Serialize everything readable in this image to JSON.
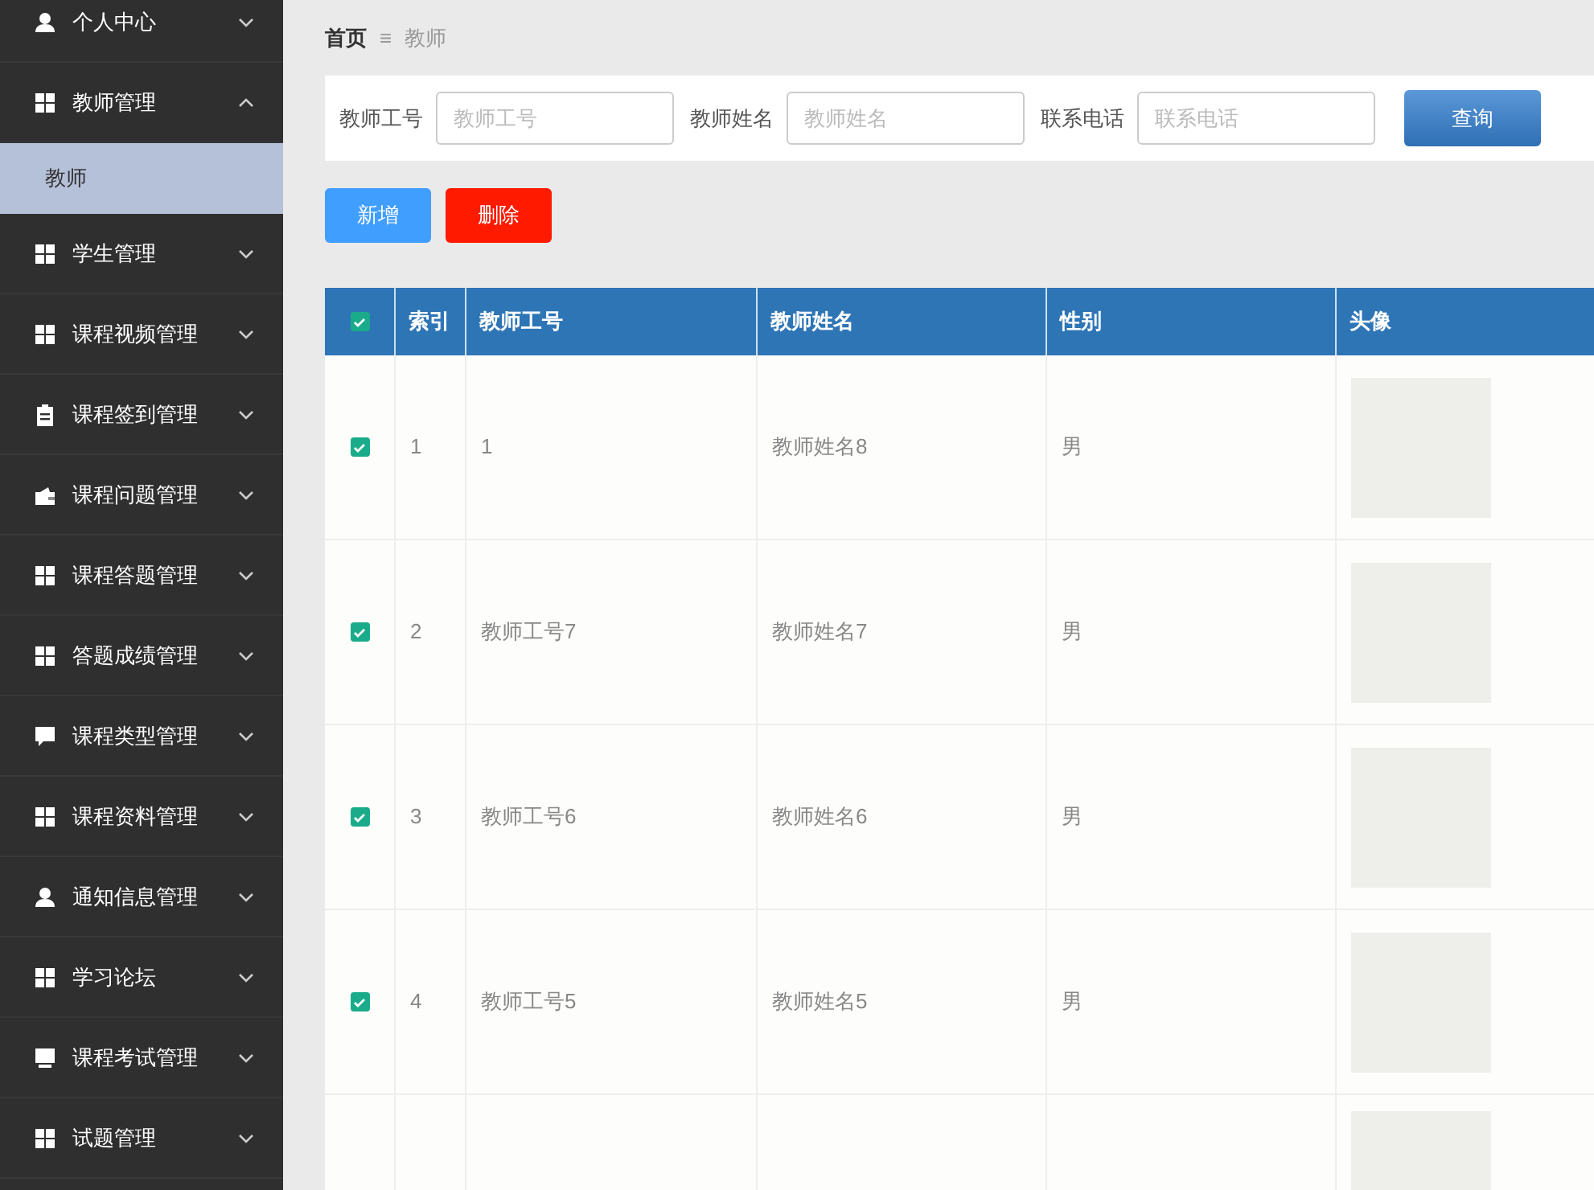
{
  "sidebar": {
    "items": [
      {
        "label": "个人中心",
        "expanded": false
      },
      {
        "label": "教师管理",
        "expanded": true,
        "children": [
          {
            "label": "教师",
            "selected": true
          }
        ]
      },
      {
        "label": "学生管理",
        "expanded": false
      },
      {
        "label": "课程视频管理",
        "expanded": false
      },
      {
        "label": "课程签到管理",
        "expanded": false
      },
      {
        "label": "课程问题管理",
        "expanded": false
      },
      {
        "label": "课程答题管理",
        "expanded": false
      },
      {
        "label": "答题成绩管理",
        "expanded": false
      },
      {
        "label": "课程类型管理",
        "expanded": false
      },
      {
        "label": "课程资料管理",
        "expanded": false
      },
      {
        "label": "通知信息管理",
        "expanded": false
      },
      {
        "label": "学习论坛",
        "expanded": false
      },
      {
        "label": "课程考试管理",
        "expanded": false
      },
      {
        "label": "试题管理",
        "expanded": false
      }
    ]
  },
  "breadcrumb": {
    "home": "首页",
    "separator": "≡",
    "current": "教师"
  },
  "search": {
    "fields": [
      {
        "label": "教师工号",
        "placeholder": "教师工号"
      },
      {
        "label": "教师姓名",
        "placeholder": "教师姓名"
      },
      {
        "label": "联系电话",
        "placeholder": "联系电话"
      }
    ],
    "button": "查询"
  },
  "actions": [
    {
      "kind": "add",
      "label": "新增"
    },
    {
      "kind": "delete",
      "label": "删除"
    }
  ],
  "table": {
    "all_checked": true,
    "columns": [
      "索引",
      "教师工号",
      "教师姓名",
      "性别",
      "头像"
    ],
    "rows": [
      {
        "checked": true,
        "index": "1",
        "teacher_id": "1",
        "name": "教师姓名8",
        "gender": "男"
      },
      {
        "checked": true,
        "index": "2",
        "teacher_id": "教师工号7",
        "name": "教师姓名7",
        "gender": "男"
      },
      {
        "checked": true,
        "index": "3",
        "teacher_id": "教师工号6",
        "name": "教师姓名6",
        "gender": "男"
      },
      {
        "checked": true,
        "index": "4",
        "teacher_id": "教师工号5",
        "name": "教师姓名5",
        "gender": "男"
      }
    ]
  }
}
